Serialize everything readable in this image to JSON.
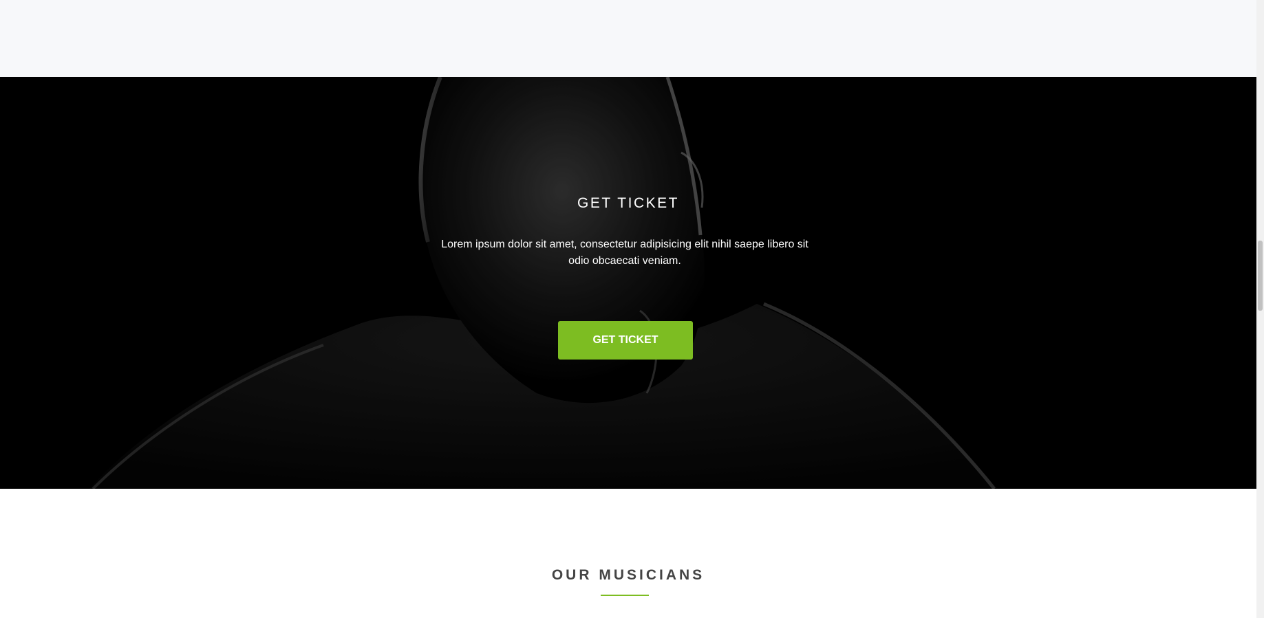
{
  "hero": {
    "title": "GET TICKET",
    "text": "Lorem ipsum dolor sit amet, consectetur adipisicing elit nihil saepe libero sit odio obcaecati veniam.",
    "button_label": "GET TICKET"
  },
  "musicians": {
    "title": "OUR MUSICIANS"
  },
  "colors": {
    "accent": "#7dbd22",
    "hero_background": "#000000",
    "top_strip_background": "#f7f8fa",
    "heading_text": "#444444"
  }
}
